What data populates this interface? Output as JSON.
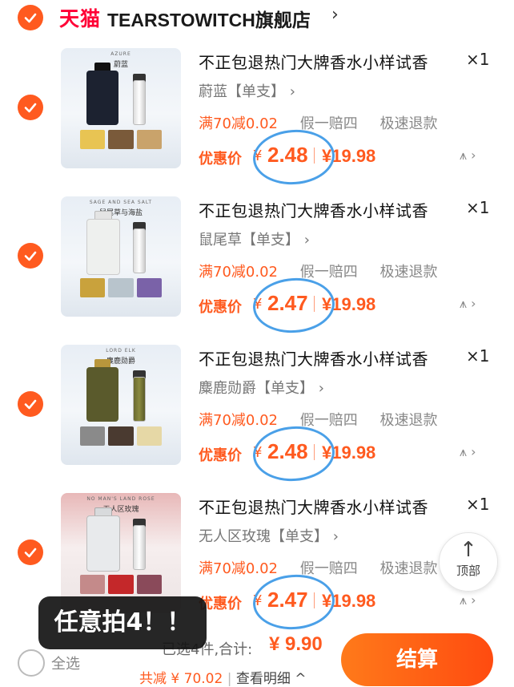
{
  "store": {
    "platform_logo": "天猫",
    "name": "TEARSTOWITCH旗舰店",
    "chevron": "›"
  },
  "items": [
    {
      "title": "不正包退热门大牌香水小样试香",
      "quantity": "×1",
      "variant": "蔚蓝【单支】",
      "promo": "满70减0.02",
      "service1": "假一赔四",
      "service2": "极速退款",
      "price_label": "优惠价",
      "currency": "¥",
      "price": "2.48",
      "original_price": "¥19.98",
      "thumb_brand": "AZURE",
      "thumb_title": "蔚蓝",
      "bottle_color": "#1c2230",
      "swatch_colors": [
        "#e8c453",
        "#7a5a3a",
        "#c9a36b"
      ]
    },
    {
      "title": "不正包退热门大牌香水小样试香",
      "quantity": "×1",
      "variant": "鼠尾草【单支】",
      "promo": "满70减0.02",
      "service1": "假一赔四",
      "service2": "极速退款",
      "price_label": "优惠价",
      "currency": "¥",
      "price": "2.47",
      "original_price": "¥19.98",
      "thumb_brand": "SAGE AND SEA SALT",
      "thumb_title": "鼠尾草与海盐",
      "bottle_color": "#eef0ee",
      "swatch_colors": [
        "#c9a23c",
        "#b8c4cc",
        "#7a62a8"
      ]
    },
    {
      "title": "不正包退热门大牌香水小样试香",
      "quantity": "×1",
      "variant": "麋鹿勋爵【单支】",
      "promo": "满70减0.02",
      "service1": "假一赔四",
      "service2": "极速退款",
      "price_label": "优惠价",
      "currency": "¥",
      "price": "2.48",
      "original_price": "¥19.98",
      "thumb_brand": "LORD ELK",
      "thumb_title": "麋鹿勋爵",
      "bottle_color": "#5a5a2c",
      "swatch_colors": [
        "#8a8a8a",
        "#4a3a30",
        "#e6d8a6"
      ]
    },
    {
      "title": "不正包退热门大牌香水小样试香",
      "quantity": "×1",
      "variant": "无人区玫瑰【单支】",
      "promo": "满70减0.02",
      "service1": "假一赔四",
      "service2": "极速退款",
      "price_label": "优惠价",
      "currency": "¥",
      "price": "2.47",
      "original_price": "¥19.98",
      "thumb_brand": "NO MAN'S LAND ROSE",
      "thumb_title": "无人区玫瑰",
      "bottle_color": "#e8eaec",
      "swatch_colors": [
        "#c48a8a",
        "#c4282a",
        "#8a4a5a"
      ]
    }
  ],
  "back_to_top": {
    "arrow": "↑",
    "label": "顶部"
  },
  "overlay_badge": "任意拍4！！",
  "footer": {
    "select_all": "全选",
    "selected_count": "已选4件,合计:",
    "total": "¥ 9.90",
    "discount_prefix": "共减 ¥ 70.02",
    "detail_link": "查看明细 ^",
    "checkout": "结算"
  },
  "colors": {
    "accent": "#ff5a1f",
    "tmall_red": "#ff0036",
    "annotation_blue": "#4aa0e8"
  }
}
